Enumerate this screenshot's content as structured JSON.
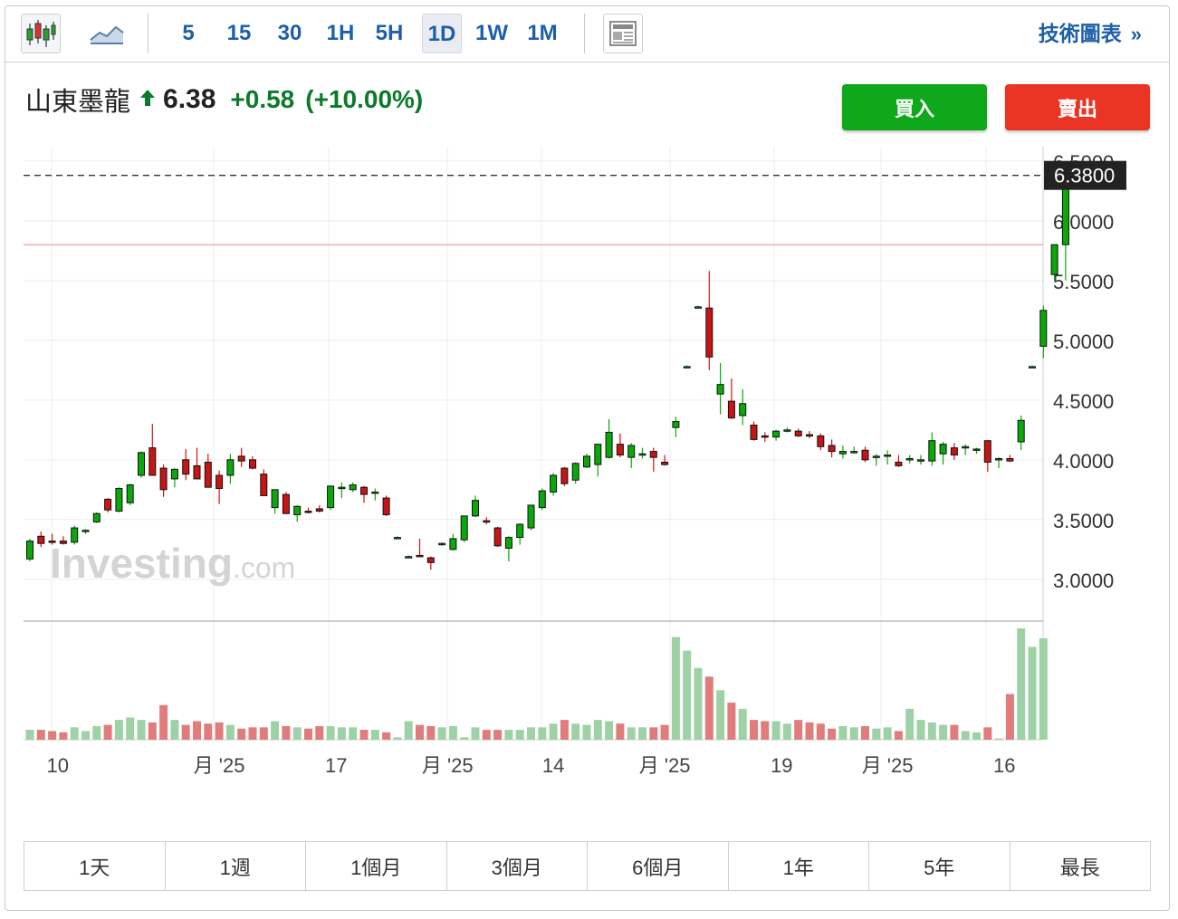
{
  "toolbar": {
    "chart_type_candle_icon": "candlestick-icon",
    "chart_type_area_icon": "area-chart-icon",
    "periods": [
      "5",
      "15",
      "30",
      "1H",
      "5H",
      "1D",
      "1W",
      "1M"
    ],
    "active_period": "1D",
    "news_icon": "news-icon",
    "advanced_chart_label": "技術圖表",
    "advanced_chart_chevron": "»"
  },
  "quote": {
    "name": "山東墨龍",
    "price": "6.38",
    "change": "+0.58",
    "change_pct": "(+10.00%)",
    "direction": "up",
    "up_color": "#0b7a2b"
  },
  "actions": {
    "buy_label": "買入",
    "buy_color": "#0fa81a",
    "sell_label": "賣出",
    "sell_color": "#ea3424"
  },
  "watermark": {
    "text": "Investing",
    "suffix": ".com"
  },
  "ranges": [
    "1天",
    "1週",
    "1個月",
    "3個月",
    "6個月",
    "1年",
    "5年",
    "最長"
  ],
  "chart_data": {
    "type": "candlestick",
    "y_ticks": [
      "6.5000",
      "6.0000",
      "5.5000",
      "5.0000",
      "4.5000",
      "4.0000",
      "3.5000",
      "3.0000"
    ],
    "ylim": [
      2.65,
      6.62
    ],
    "current_price_label": "6.3800",
    "current_price": 6.38,
    "previous_close": 5.8,
    "x_tick_labels": [
      "10",
      "月 '25",
      "17",
      "月 '25",
      "14",
      "月 '25",
      "19",
      "月 '25",
      "16"
    ],
    "x_tick_index": [
      2.5,
      17,
      27.5,
      37.5,
      47,
      57,
      67.5,
      77,
      87.5
    ],
    "up_color": "#0aa80a",
    "down_color": "#c81414",
    "up_volume_color": "#9fd1a7",
    "down_volume_color": "#e07c7c",
    "grid": true,
    "candles": [
      [
        3.17,
        3.34,
        3.15,
        3.32
      ],
      [
        3.36,
        3.4,
        3.27,
        3.3
      ],
      [
        3.32,
        3.38,
        3.29,
        3.31
      ],
      [
        3.32,
        3.36,
        3.29,
        3.3
      ],
      [
        3.31,
        3.45,
        3.29,
        3.43
      ],
      [
        3.4,
        3.42,
        3.38,
        3.41
      ],
      [
        3.48,
        3.56,
        3.47,
        3.55
      ],
      [
        3.67,
        3.68,
        3.56,
        3.58
      ],
      [
        3.57,
        3.77,
        3.56,
        3.76
      ],
      [
        3.64,
        3.8,
        3.62,
        3.79
      ],
      [
        3.87,
        4.07,
        3.85,
        4.06
      ],
      [
        4.1,
        4.3,
        3.88,
        3.87
      ],
      [
        3.93,
        3.96,
        3.69,
        3.75
      ],
      [
        3.84,
        3.93,
        3.77,
        3.92
      ],
      [
        4.0,
        4.09,
        3.83,
        3.88
      ],
      [
        3.95,
        4.1,
        3.84,
        3.84
      ],
      [
        3.98,
        4.05,
        3.77,
        3.77
      ],
      [
        3.87,
        3.91,
        3.63,
        3.76
      ],
      [
        3.87,
        4.05,
        3.8,
        4.0
      ],
      [
        4.03,
        4.1,
        3.94,
        3.99
      ],
      [
        4.0,
        4.03,
        3.92,
        3.93
      ],
      [
        3.88,
        3.92,
        3.71,
        3.7
      ],
      [
        3.6,
        3.75,
        3.55,
        3.75
      ],
      [
        3.71,
        3.73,
        3.58,
        3.55
      ],
      [
        3.54,
        3.62,
        3.48,
        3.61
      ],
      [
        3.57,
        3.6,
        3.55,
        3.56
      ],
      [
        3.59,
        3.62,
        3.56,
        3.57
      ],
      [
        3.6,
        3.78,
        3.58,
        3.78
      ],
      [
        3.77,
        3.81,
        3.68,
        3.77
      ],
      [
        3.75,
        3.81,
        3.73,
        3.79
      ],
      [
        3.77,
        3.78,
        3.64,
        3.71
      ],
      [
        3.72,
        3.76,
        3.66,
        3.73
      ],
      [
        3.68,
        3.7,
        3.53,
        3.54
      ],
      [
        3.35,
        3.36,
        3.34,
        3.35
      ],
      [
        3.19,
        3.2,
        3.18,
        3.19
      ],
      [
        3.2,
        3.34,
        3.19,
        3.19
      ],
      [
        3.18,
        3.19,
        3.08,
        3.14
      ],
      [
        3.29,
        3.31,
        3.28,
        3.3
      ],
      [
        3.25,
        3.38,
        3.24,
        3.34
      ],
      [
        3.33,
        3.53,
        3.31,
        3.53
      ],
      [
        3.53,
        3.7,
        3.52,
        3.66
      ],
      [
        3.49,
        3.52,
        3.46,
        3.48
      ],
      [
        3.43,
        3.44,
        3.27,
        3.28
      ],
      [
        3.26,
        3.36,
        3.15,
        3.35
      ],
      [
        3.35,
        3.47,
        3.29,
        3.46
      ],
      [
        3.43,
        3.59,
        3.41,
        3.62
      ],
      [
        3.6,
        3.76,
        3.58,
        3.74
      ],
      [
        3.73,
        3.89,
        3.7,
        3.87
      ],
      [
        3.93,
        3.94,
        3.78,
        3.8
      ],
      [
        3.83,
        3.98,
        3.8,
        3.97
      ],
      [
        3.94,
        4.05,
        3.93,
        4.03
      ],
      [
        3.96,
        4.13,
        3.86,
        4.13
      ],
      [
        4.02,
        4.34,
        4.01,
        4.23
      ],
      [
        4.13,
        4.22,
        4.02,
        4.04
      ],
      [
        4.02,
        4.14,
        3.93,
        4.12
      ],
      [
        4.04,
        4.1,
        4.01,
        4.05
      ],
      [
        4.07,
        4.1,
        3.9,
        4.02
      ],
      [
        3.98,
        4.04,
        3.95,
        3.96
      ],
      [
        4.27,
        4.36,
        4.19,
        4.32
      ],
      [
        4.78,
        4.79,
        4.77,
        4.78
      ],
      [
        5.28,
        5.29,
        5.27,
        5.28
      ],
      [
        5.27,
        5.58,
        4.75,
        4.86
      ],
      [
        4.55,
        4.81,
        4.38,
        4.63
      ],
      [
        4.49,
        4.68,
        4.34,
        4.35
      ],
      [
        4.37,
        4.59,
        4.29,
        4.47
      ],
      [
        4.29,
        4.32,
        4.16,
        4.17
      ],
      [
        4.2,
        4.23,
        4.15,
        4.19
      ],
      [
        4.19,
        4.25,
        4.16,
        4.24
      ],
      [
        4.24,
        4.27,
        4.23,
        4.25
      ],
      [
        4.24,
        4.26,
        4.19,
        4.2
      ],
      [
        4.21,
        4.24,
        4.18,
        4.2
      ],
      [
        4.2,
        4.22,
        4.08,
        4.11
      ],
      [
        4.12,
        4.17,
        4.02,
        4.07
      ],
      [
        4.05,
        4.12,
        4.01,
        4.07
      ],
      [
        4.07,
        4.11,
        4.05,
        4.07
      ],
      [
        4.08,
        4.11,
        3.98,
        4.0
      ],
      [
        4.03,
        4.05,
        3.95,
        4.03
      ],
      [
        4.04,
        4.08,
        3.96,
        4.04
      ],
      [
        3.98,
        4.04,
        3.94,
        3.95
      ],
      [
        4.0,
        4.04,
        3.97,
        4.01
      ],
      [
        4.0,
        4.04,
        3.96,
        4.0
      ],
      [
        3.99,
        4.23,
        3.95,
        4.16
      ],
      [
        4.05,
        4.15,
        3.96,
        4.13
      ],
      [
        4.1,
        4.14,
        4.0,
        4.04
      ],
      [
        4.1,
        4.13,
        4.04,
        4.11
      ],
      [
        4.08,
        4.1,
        4.05,
        4.09
      ],
      [
        4.16,
        4.16,
        3.9,
        3.98
      ],
      [
        4.0,
        4.02,
        3.93,
        4.01
      ],
      [
        4.01,
        4.04,
        3.98,
        3.99
      ],
      [
        4.15,
        4.37,
        4.08,
        4.33
      ],
      [
        4.78,
        4.79,
        4.77,
        4.78
      ],
      [
        4.95,
        5.29,
        4.85,
        5.25
      ],
      [
        5.55,
        5.8,
        5.5,
        5.8
      ],
      [
        5.8,
        6.38,
        5.5,
        6.38
      ]
    ],
    "volumes": [
      8,
      8,
      7,
      6,
      10,
      7,
      11,
      12,
      16,
      18,
      16,
      14,
      28,
      16,
      12,
      15,
      13,
      14,
      12,
      9,
      10,
      10,
      15,
      11,
      10,
      9,
      11,
      11,
      10,
      10,
      8,
      8,
      6,
      2,
      15,
      12,
      11,
      10,
      11,
      2,
      10,
      8,
      8,
      8,
      8,
      10,
      10,
      13,
      16,
      13,
      12,
      16,
      15,
      13,
      10,
      10,
      10,
      12,
      83,
      72,
      58,
      51,
      40,
      30,
      25,
      16,
      15,
      15,
      13,
      16,
      14,
      13,
      9,
      11,
      10,
      11,
      9,
      10,
      7,
      25,
      16,
      14,
      12,
      12,
      7,
      6,
      10,
      1,
      37,
      90,
      75,
      82
    ]
  }
}
